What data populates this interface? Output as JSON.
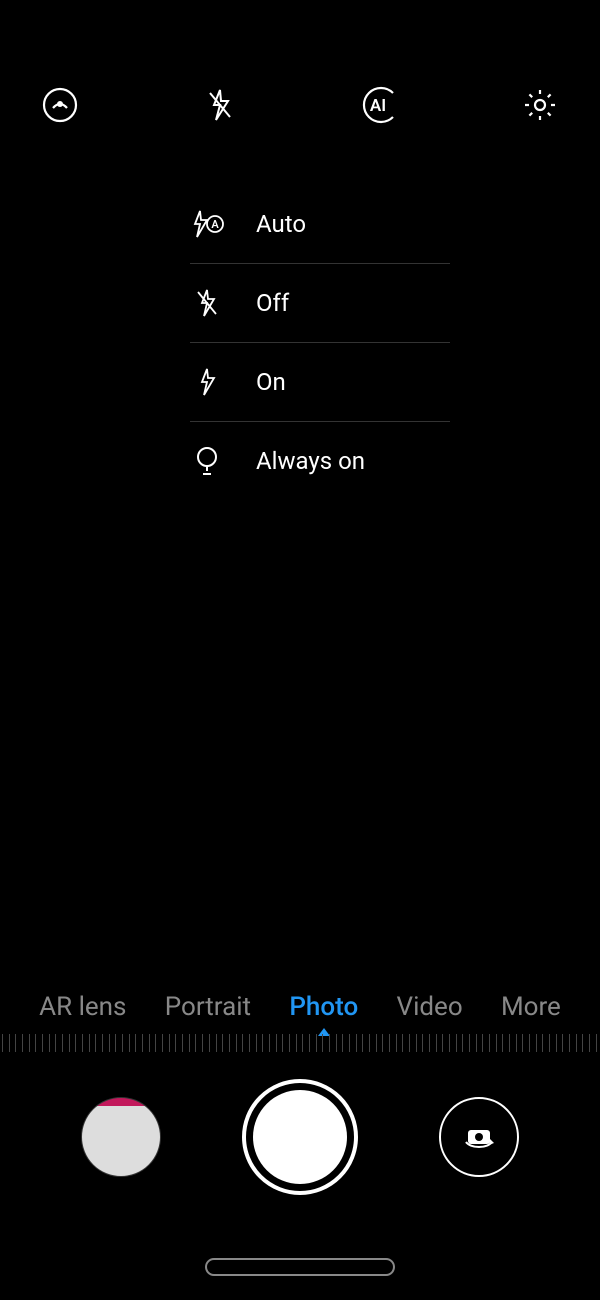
{
  "top_icons": {
    "beauty": "beauty-icon",
    "flash": "flash-off-icon",
    "ai": "ai-icon",
    "settings": "gear-icon"
  },
  "flash_menu": {
    "items": [
      {
        "icon": "flash-auto-icon",
        "label": "Auto"
      },
      {
        "icon": "flash-off-icon",
        "label": "Off"
      },
      {
        "icon": "flash-on-icon",
        "label": "On"
      },
      {
        "icon": "flash-always-icon",
        "label": "Always on"
      }
    ]
  },
  "modes": {
    "items": [
      {
        "label": "AR lens",
        "active": false
      },
      {
        "label": "Portrait",
        "active": false
      },
      {
        "label": "Photo",
        "active": true
      },
      {
        "label": "Video",
        "active": false
      },
      {
        "label": "More",
        "active": false
      }
    ]
  },
  "colors": {
    "accent": "#2196f3"
  }
}
